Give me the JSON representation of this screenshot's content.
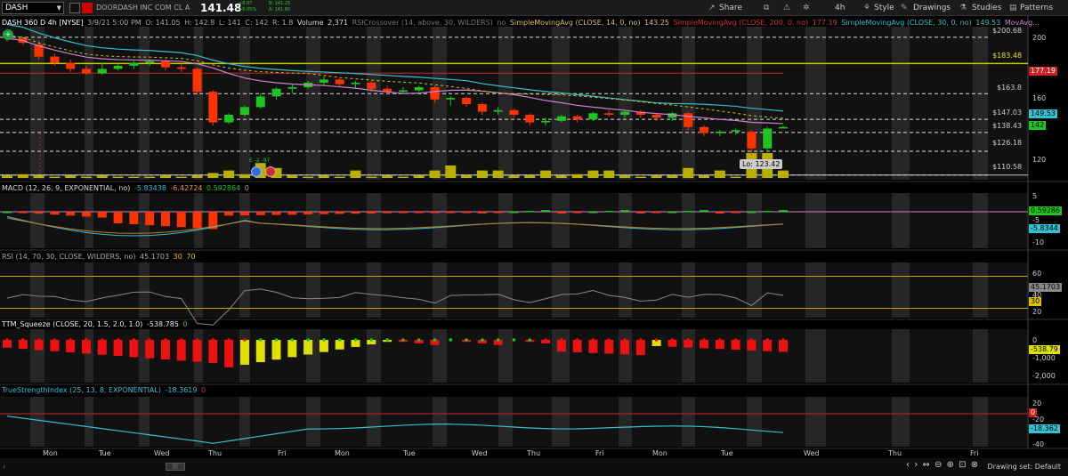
{
  "symbol": "DASH",
  "header": {
    "company": "DOORDASH INC COM CL A",
    "last_price": "141.48",
    "change_lines": [
      "+8.07",
      "+6.05%"
    ],
    "bid_ask_lines": [
      "B: 141.25",
      "A: 141.80"
    ],
    "toolbar": {
      "share": "Share",
      "timeframe": "4h",
      "style": "Style",
      "drawings": "Drawings",
      "studies": "Studies",
      "patterns": "Patterns"
    }
  },
  "price_panel": {
    "legend": {
      "title": "DASH 360 D 4h [NYSE]",
      "datetime": "3/9/21 5:00 PM",
      "ohlc": [
        "O: 141.05",
        "H: 142.8",
        "L: 141",
        "C: 142",
        "R: 1.8"
      ],
      "volume_label": "Volume",
      "volume_value": "2,371",
      "rsi_crossover": "RSICrossover (14, above, 30, WILDERS)",
      "rsi_crossover_value": "no",
      "sma14": "SimpleMovingAvg (CLOSE, 14, 0, no)",
      "sma14_value": "143.25",
      "sma200": "SimpleMovingAvg (CLOSE, 200, 0, no)",
      "sma200_value": "177.19",
      "sma30": "SimpleMovingAvg (CLOSE, 30, 0, no)",
      "sma30_value": "149.53",
      "movavg": "MovAvg..."
    },
    "level_labels": [
      "$200.68",
      "$183.48",
      "$163.8",
      "$147.03",
      "$138.43",
      "$126.18",
      "$110.58"
    ],
    "axis_ticks": [
      "200",
      "180",
      "160",
      "140",
      "120"
    ],
    "price_tags": {
      "sma200": "177.19",
      "sma30": "149.53",
      "last": "142"
    },
    "low_label": "Lo: 123.42",
    "marker_text": "E -2 -97"
  },
  "macd_panel": {
    "title": "MACD (12, 26, 9, EXPONENTIAL, no)",
    "values": [
      "-5.83438",
      "-6.42724",
      "0.592864",
      "0"
    ],
    "axis_ticks": [
      "5",
      "-5",
      "-10"
    ],
    "tags": [
      "0.59286",
      "-5.8344"
    ]
  },
  "rsi_panel": {
    "title": "RSI (14, 70, 30, CLOSE, WILDERS, no)",
    "values": [
      "45.1703",
      "30",
      "70"
    ],
    "axis_ticks": [
      "60",
      "40",
      "20"
    ],
    "tags": [
      "45.1703",
      "30"
    ]
  },
  "ttm_panel": {
    "title": "TTM_Squeeze (CLOSE, 20, 1.5, 2.0, 1.0)",
    "values": [
      "-538.785",
      "0"
    ],
    "axis_ticks": [
      "0",
      "-1,000",
      "-2,000"
    ],
    "tags": [
      "-538.79"
    ]
  },
  "tsi_panel": {
    "title": "TrueStrengthIndex (25, 13, 8, EXPONENTIAL)",
    "values": [
      "-18.3619",
      "0"
    ],
    "axis_ticks": [
      "20",
      "-20",
      "-40"
    ],
    "tags": [
      "0",
      "-18.362"
    ]
  },
  "x_axis": [
    "Mon",
    "Tue",
    "Wed",
    "Thu",
    "Fri",
    "Mon",
    "Tue",
    "Wed",
    "Thu",
    "Fri",
    "Mon",
    "Tue",
    "Wed",
    "Thu",
    "Fri"
  ],
  "footer": {
    "drawing_set": "Drawing set: Default"
  },
  "colors": {
    "up": "#1fc41f",
    "down": "#ff3300",
    "volume": "#b8b000",
    "sma30": "#33c0d0",
    "sma14": "#d080d0",
    "sma200": "#cc2222",
    "level": "#c8c800"
  },
  "chart_data": {
    "type": "candlestick",
    "timeframe": "4h",
    "candles": [
      {
        "o": 204,
        "h": 206,
        "l": 198,
        "c": 200
      },
      {
        "o": 200,
        "h": 201,
        "l": 196,
        "c": 197
      },
      {
        "o": 196,
        "h": 198,
        "l": 186,
        "c": 188
      },
      {
        "o": 188,
        "h": 190,
        "l": 182,
        "c": 184
      },
      {
        "o": 184,
        "h": 186,
        "l": 178,
        "c": 180
      },
      {
        "o": 180,
        "h": 182,
        "l": 176,
        "c": 177
      },
      {
        "o": 177,
        "h": 184,
        "l": 176,
        "c": 180
      },
      {
        "o": 180,
        "h": 183,
        "l": 179,
        "c": 182
      },
      {
        "o": 182,
        "h": 185,
        "l": 180,
        "c": 184
      },
      {
        "o": 184,
        "h": 186,
        "l": 182,
        "c": 185
      },
      {
        "o": 185,
        "h": 186,
        "l": 179,
        "c": 181
      },
      {
        "o": 181,
        "h": 183,
        "l": 178,
        "c": 180
      },
      {
        "o": 180,
        "h": 181,
        "l": 163,
        "c": 165
      },
      {
        "o": 165,
        "h": 166,
        "l": 143,
        "c": 145
      },
      {
        "o": 145,
        "h": 151,
        "l": 144,
        "c": 150
      },
      {
        "o": 150,
        "h": 156,
        "l": 149,
        "c": 155
      },
      {
        "o": 155,
        "h": 164,
        "l": 154,
        "c": 162
      },
      {
        "o": 162,
        "h": 168,
        "l": 160,
        "c": 167
      },
      {
        "o": 167,
        "h": 170,
        "l": 164,
        "c": 168
      },
      {
        "o": 168,
        "h": 172,
        "l": 167,
        "c": 171
      },
      {
        "o": 171,
        "h": 175,
        "l": 169,
        "c": 173
      },
      {
        "o": 173,
        "h": 174,
        "l": 168,
        "c": 170
      },
      {
        "o": 170,
        "h": 172,
        "l": 167,
        "c": 171
      },
      {
        "o": 171,
        "h": 172,
        "l": 165,
        "c": 167
      },
      {
        "o": 167,
        "h": 169,
        "l": 163,
        "c": 165
      },
      {
        "o": 165,
        "h": 168,
        "l": 164,
        "c": 166
      },
      {
        "o": 166,
        "h": 169,
        "l": 165,
        "c": 168
      },
      {
        "o": 168,
        "h": 169,
        "l": 158,
        "c": 160
      },
      {
        "o": 160,
        "h": 162,
        "l": 156,
        "c": 161
      },
      {
        "o": 161,
        "h": 162,
        "l": 155,
        "c": 157
      },
      {
        "o": 157,
        "h": 158,
        "l": 150,
        "c": 152
      },
      {
        "o": 152,
        "h": 155,
        "l": 150,
        "c": 153
      },
      {
        "o": 153,
        "h": 154,
        "l": 148,
        "c": 150
      },
      {
        "o": 150,
        "h": 151,
        "l": 143,
        "c": 145
      },
      {
        "o": 145,
        "h": 148,
        "l": 143,
        "c": 146
      },
      {
        "o": 146,
        "h": 150,
        "l": 145,
        "c": 149
      },
      {
        "o": 149,
        "h": 150,
        "l": 145,
        "c": 147
      },
      {
        "o": 147,
        "h": 152,
        "l": 146,
        "c": 151
      },
      {
        "o": 151,
        "h": 153,
        "l": 149,
        "c": 150
      },
      {
        "o": 150,
        "h": 153,
        "l": 148,
        "c": 152
      },
      {
        "o": 152,
        "h": 153,
        "l": 148,
        "c": 150
      },
      {
        "o": 150,
        "h": 151,
        "l": 146,
        "c": 148
      },
      {
        "o": 148,
        "h": 152,
        "l": 146,
        "c": 151
      },
      {
        "o": 151,
        "h": 152,
        "l": 140,
        "c": 142
      },
      {
        "o": 142,
        "h": 143,
        "l": 136,
        "c": 138
      },
      {
        "o": 138,
        "h": 140,
        "l": 136,
        "c": 139
      },
      {
        "o": 139,
        "h": 141,
        "l": 137,
        "c": 140
      },
      {
        "o": 139,
        "h": 140,
        "l": 123.42,
        "c": 128
      },
      {
        "o": 128,
        "h": 142,
        "l": 126,
        "c": 141
      },
      {
        "o": 141.05,
        "h": 142.8,
        "l": 141,
        "c": 142
      }
    ],
    "volume_rel": [
      0.1,
      0.15,
      0.1,
      0.05,
      0.1,
      0.05,
      0.1,
      0.05,
      0.05,
      0.05,
      0.1,
      0.05,
      0.1,
      0.2,
      0.3,
      0.15,
      0.6,
      0.4,
      0.1,
      0.05,
      0.1,
      0.05,
      0.3,
      0.05,
      0.1,
      0.05,
      0.1,
      0.3,
      0.5,
      0.1,
      0.3,
      0.3,
      0.1,
      0.1,
      0.3,
      0.1,
      0.15,
      0.3,
      0.3,
      0.1,
      0.05,
      0.1,
      0.1,
      0.4,
      0.1,
      0.3,
      0.05,
      1.0,
      1.0,
      0.3
    ]
  }
}
